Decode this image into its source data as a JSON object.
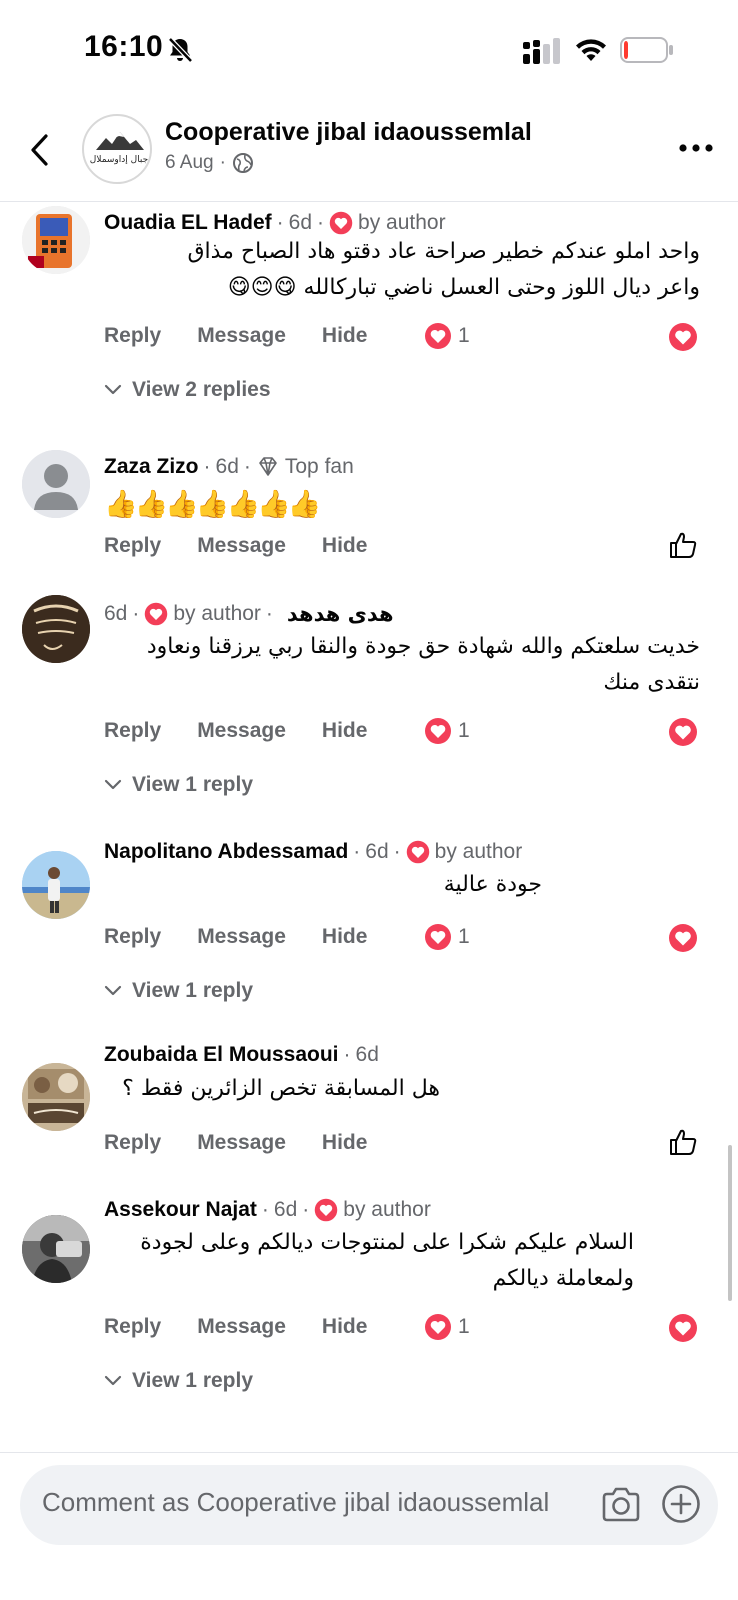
{
  "status_bar": {
    "time": "16:10",
    "battery_level": 0.1,
    "battery_color": "#ff3b30"
  },
  "header": {
    "page_name": "Cooperative jibal idaoussemlal",
    "post_date": "6 Aug",
    "audience_icon": "globe-icon",
    "logo_text": "جبال إداوسملال"
  },
  "labels": {
    "reply": "Reply",
    "message": "Message",
    "hide": "Hide",
    "by_author": "by author",
    "top_fan": "Top fan"
  },
  "comments": [
    {
      "author": "Ouadia EL Hadef",
      "time": "6d",
      "badge": "by author",
      "text_line1": "واحد املو عندكم خطير صراحة عاد دقتو هاد الصباح مذاق",
      "text_line2": "واعر ديال اللوز وحتى العسل ناضي تباركالله 😋😊😋",
      "reactions": "1",
      "view_replies": "View 2 replies"
    },
    {
      "author": "Zaza Zizo",
      "time": "6d",
      "badge": "Top fan",
      "text_line1": "👍👍👍👍👍👍👍"
    },
    {
      "author": "هدى هدهد",
      "time": "6d",
      "badge": "by author",
      "text_line1": "خديت سلعتكم والله شهادة حق جودة والنقا ربي يرزقنا ونعاود",
      "text_line2": "نتقدى منك",
      "reactions": "1",
      "view_replies": "View 1 reply"
    },
    {
      "author": "Napolitano Abdessamad",
      "time": "6d",
      "badge": "by author",
      "text_line1": "جودة عالية",
      "reactions": "1",
      "view_replies": "View 1 reply"
    },
    {
      "author": "Zoubaida El Moussaoui",
      "time": "6d",
      "text_line1": "هل المسابقة تخص الزائرين فقط ؟"
    },
    {
      "author": "Assekour Najat",
      "time": "6d",
      "badge": "by author",
      "text_line1": "السلام عليكم شكرا على لمنتوجات ديالكم وعلى لجودة",
      "text_line2": "ولمعاملة ديالكم",
      "reactions": "1",
      "view_replies": "View 1 reply"
    }
  ],
  "composer": {
    "placeholder": "Comment as Cooperative jibal idaoussemlal"
  },
  "colors": {
    "love_red": "#f33e58",
    "secondary_text": "#65676b",
    "composer_bg": "#f0f2f5"
  }
}
